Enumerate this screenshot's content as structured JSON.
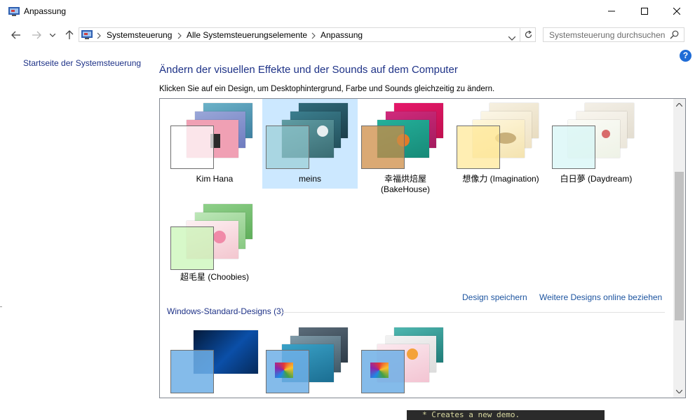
{
  "window": {
    "title": "Anpassung"
  },
  "breadcrumb": {
    "items": [
      "Systemsteuerung",
      "Alle Systemsteuerungselemente",
      "Anpassung"
    ]
  },
  "search": {
    "placeholder": "Systemsteuerung durchsuchen"
  },
  "sidebar": {
    "home_link": "Startseite der Systemsteuerung"
  },
  "help": {
    "label": "?"
  },
  "main": {
    "heading": "Ändern der visuellen Effekte und der Sounds auf dem Computer",
    "description": "Klicken Sie auf ein Design, um Desktophintergrund, Farbe und Sounds gleichzeitig zu ändern."
  },
  "my_themes": [
    {
      "name": "Kim Hana",
      "selected": false
    },
    {
      "name": "meins",
      "selected": true
    },
    {
      "name": "幸福烘焙屋\n(BakeHouse)",
      "selected": false
    },
    {
      "name": "想像力 (Imagination)",
      "selected": false
    },
    {
      "name": "白日夢 (Daydream)",
      "selected": false
    },
    {
      "name": "超毛星 (Choobies)",
      "selected": false
    }
  ],
  "actions": {
    "save_design": "Design speichern",
    "more_online": "Weitere Designs online beziehen"
  },
  "standard_section": {
    "heading": "Windows-Standard-Designs (3)"
  },
  "terminal": {
    "text": "* Creates a new demo."
  },
  "colors": {
    "accent": "#1e3287",
    "link": "#1e55a0",
    "selection": "#cce8ff",
    "help": "#1f6cd6"
  }
}
